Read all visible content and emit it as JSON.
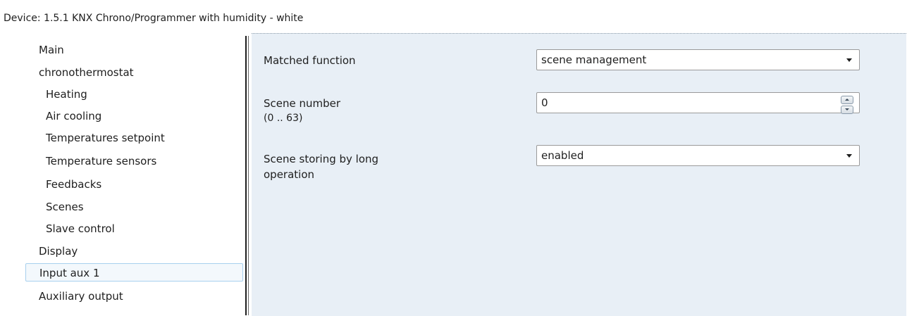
{
  "window": {
    "title": "Device: 1.5.1  KNX Chrono/Programmer with humidity - white"
  },
  "sidebar": {
    "items": [
      {
        "label": "Main",
        "level": 1
      },
      {
        "label": "chronothermostat",
        "level": 1
      },
      {
        "label": "Heating",
        "level": 2
      },
      {
        "label": "Air cooling",
        "level": 2
      },
      {
        "label": "Temperatures setpoint",
        "level": 2
      },
      {
        "label": "Temperature sensors",
        "level": 2
      },
      {
        "label": "Feedbacks",
        "level": 2
      },
      {
        "label": "Scenes",
        "level": 2
      },
      {
        "label": "Slave control",
        "level": 2
      },
      {
        "label": "Display",
        "level": 1
      },
      {
        "label": "Input aux 1",
        "level": 1,
        "selected": true
      },
      {
        "label": "Auxiliary output",
        "level": 1
      }
    ]
  },
  "params": {
    "matched_function": {
      "label": "Matched function",
      "value": "scene management"
    },
    "scene_number": {
      "label": "Scene number",
      "range": "(0 .. 63)",
      "value": "0"
    },
    "scene_storing": {
      "label_line1": "Scene storing by long",
      "label_line2": "operation",
      "value": "enabled"
    }
  },
  "icons": {
    "dropdown": "chevron-down-icon",
    "spin_up": "spin-up-icon",
    "spin_down": "spin-down-icon"
  },
  "colors": {
    "content_bg": "#e8eff6",
    "selection_bg": "#f3f8fc",
    "selection_border": "#a8d0ee"
  }
}
